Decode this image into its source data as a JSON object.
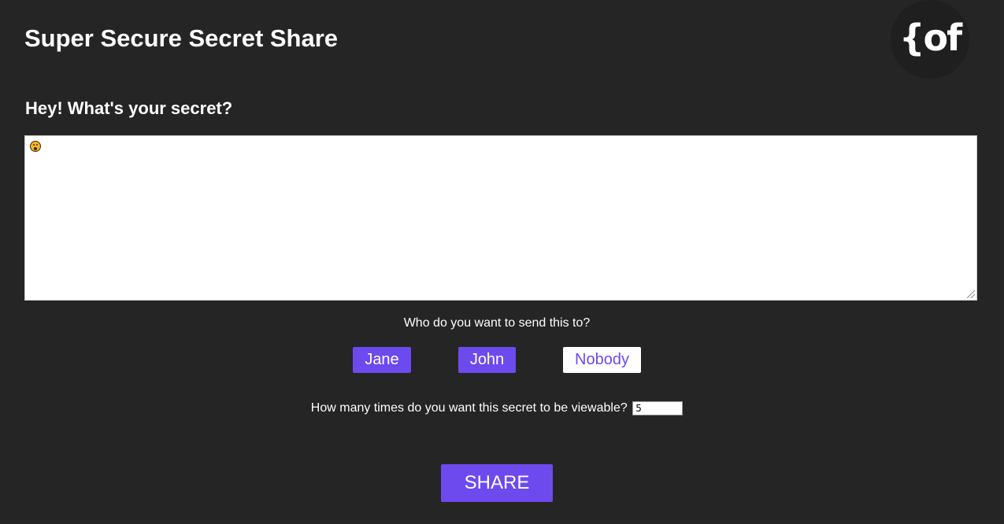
{
  "header": {
    "title": "Super Secure Secret Share",
    "logo_text": "{of"
  },
  "form": {
    "heading": "Hey! What's your secret?",
    "secret_content_icon": "astonished-face-emoji",
    "recipient_question": "Who do you want to send this to?",
    "recipients": [
      {
        "label": "Jane",
        "style": "purple"
      },
      {
        "label": "John",
        "style": "purple"
      },
      {
        "label": "Nobody",
        "style": "white"
      }
    ],
    "views_question": "How many times do you want this secret to be viewable?",
    "views_value": "5",
    "share_label": "SHARE"
  },
  "colors": {
    "background": "#252525",
    "accent": "#6d4aee",
    "text": "#ffffff"
  }
}
